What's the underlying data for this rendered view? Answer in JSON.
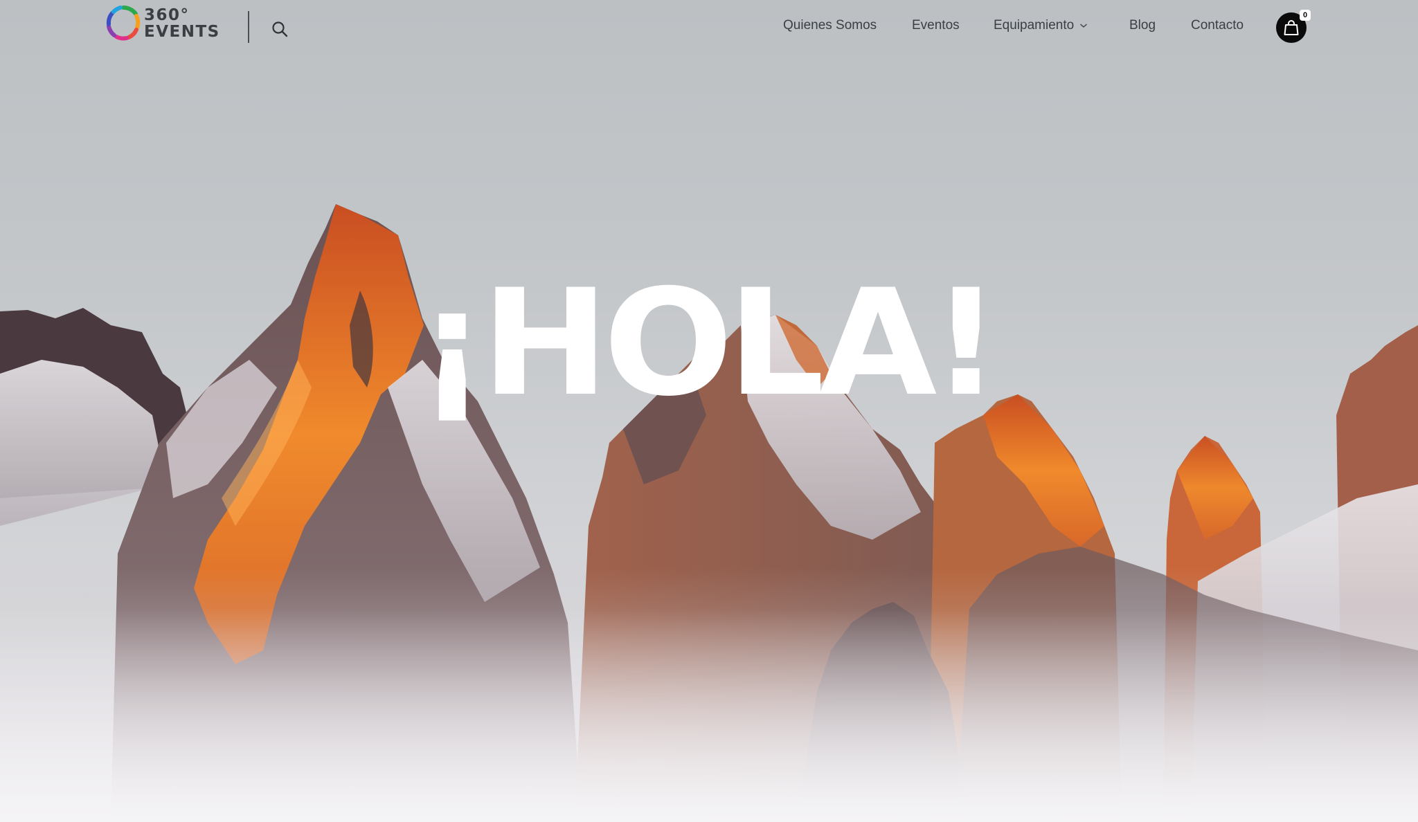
{
  "brand": {
    "name_line1": "360°",
    "name_line2": "EVENTS",
    "ring_colors": [
      "#2aa84a",
      "#21a3e0",
      "#3a4fc1",
      "#8b3fb0",
      "#e0308a",
      "#e94b3c",
      "#f4a021"
    ]
  },
  "header": {
    "search_icon": "search-icon",
    "nav": [
      {
        "label": "Quienes Somos"
      },
      {
        "label": "Eventos"
      },
      {
        "label": "Equipamiento",
        "has_dropdown": true,
        "dropdown_icon": "chevron-down-icon"
      },
      {
        "label": "Blog"
      },
      {
        "label": "Contacto"
      }
    ],
    "cart": {
      "icon": "shopping-bag-icon",
      "count": "0"
    }
  },
  "hero": {
    "title": "¡HOLA!",
    "image": "mountain-peaks-photo",
    "colors": {
      "sky": "#c2c5c8",
      "rock_glow": "#e8762a",
      "rock_dark": "#5a4a4c",
      "snow": "#e6e3e8"
    }
  }
}
